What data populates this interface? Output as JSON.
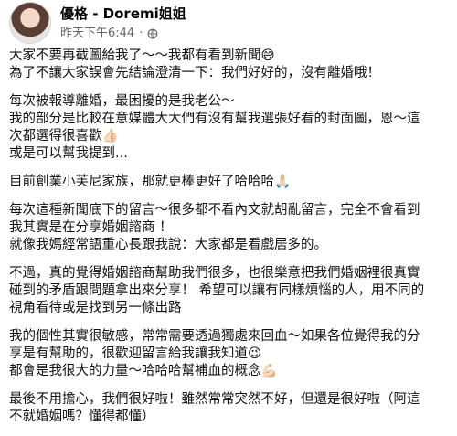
{
  "post": {
    "author": "優格 - Doremi姐姐",
    "timestamp": "昨天下午6:44",
    "separator": "·",
    "privacy_icon": "globe-icon",
    "paragraphs": [
      [
        "大家不要再截圖給我了～～我都有看到新聞😅",
        "為了不讓大家誤會先結論澄清一下：我們好好的，沒有離婚哦！"
      ],
      [
        "每次被報導離婚，最困擾的是我老公～",
        "我的部分是比較在意媒體大大們有沒有幫我選張好看的封面圖，恩～這",
        "次都選得很喜歡👍🏻",
        "或是可以幫我提到..."
      ],
      [
        "目前創業小芙尼家族，那就更棒更好了哈哈哈🙏🏻"
      ],
      [
        "每次這種新聞底下的留言～很多都不看內文就胡亂留言，完全不會看到",
        "我其實是在分享婚姻諮商 ！",
        "就像我媽經常語重心長跟我說：大家都是看戲居多的。"
      ],
      [
        "不過，真的覺得婚姻諮商幫助我們很多，也很樂意把我們婚姻裡很真實",
        "碰到的矛盾跟問題拿出來分享！ 希望可以讓有同樣煩惱的人，用不同的",
        "視角看待或是找到另一條出路"
      ],
      [
        "我的個性其實很敏感，常常需要透過獨處來回血～如果各位覺得我的分",
        "享是有幫助的，很歡迎留言給我讓我知道😉",
        "都會是我很大的力量～哈哈哈幫補血的概念💪🏻"
      ],
      [
        "最後不用擔心，我們很好啦！雖然常常突然不好，但還是很好啦（阿這",
        "不就婚姻嗎？懂得都懂）"
      ]
    ]
  }
}
